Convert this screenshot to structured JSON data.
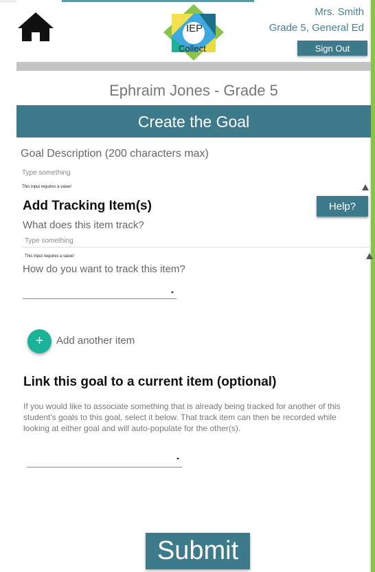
{
  "header": {
    "teacher_name": "Mrs. Smith",
    "teacher_grade": "Grade 5, General Ed",
    "sign_out_label": "Sign Out",
    "logo_line1": "IEP",
    "logo_line2": "Collect"
  },
  "student": {
    "title": "Ephraim Jones - Grade 5"
  },
  "page": {
    "title": "Create the Goal"
  },
  "goal": {
    "label": "Goal Description (200 characters max)",
    "placeholder": "Type something",
    "error": "This input requires a value!"
  },
  "tracking": {
    "heading": "Add Tracking Item(s)",
    "help_label": "Help?",
    "what_label": "What does this item track?",
    "what_placeholder": "Type something",
    "what_error": "This input requires a value!",
    "how_label": "How do you want to track this item?",
    "how_selected": "",
    "add_label": "Add another item",
    "add_icon": "+"
  },
  "link": {
    "heading": "Link this goal to a current item (optional)",
    "description": "If you would like to associate something that is already being tracked for another of this student's goals to this goal, select it below. That track item can then be recorded while looking at either goal and will auto-populate for the other(s).",
    "selected": ""
  },
  "submit_label": "Submit",
  "colors": {
    "primary": "#3d7a8c",
    "accent_green": "#1bb29a",
    "frame_green": "#8bc34a",
    "grey_bar": "#c4c4c4"
  }
}
